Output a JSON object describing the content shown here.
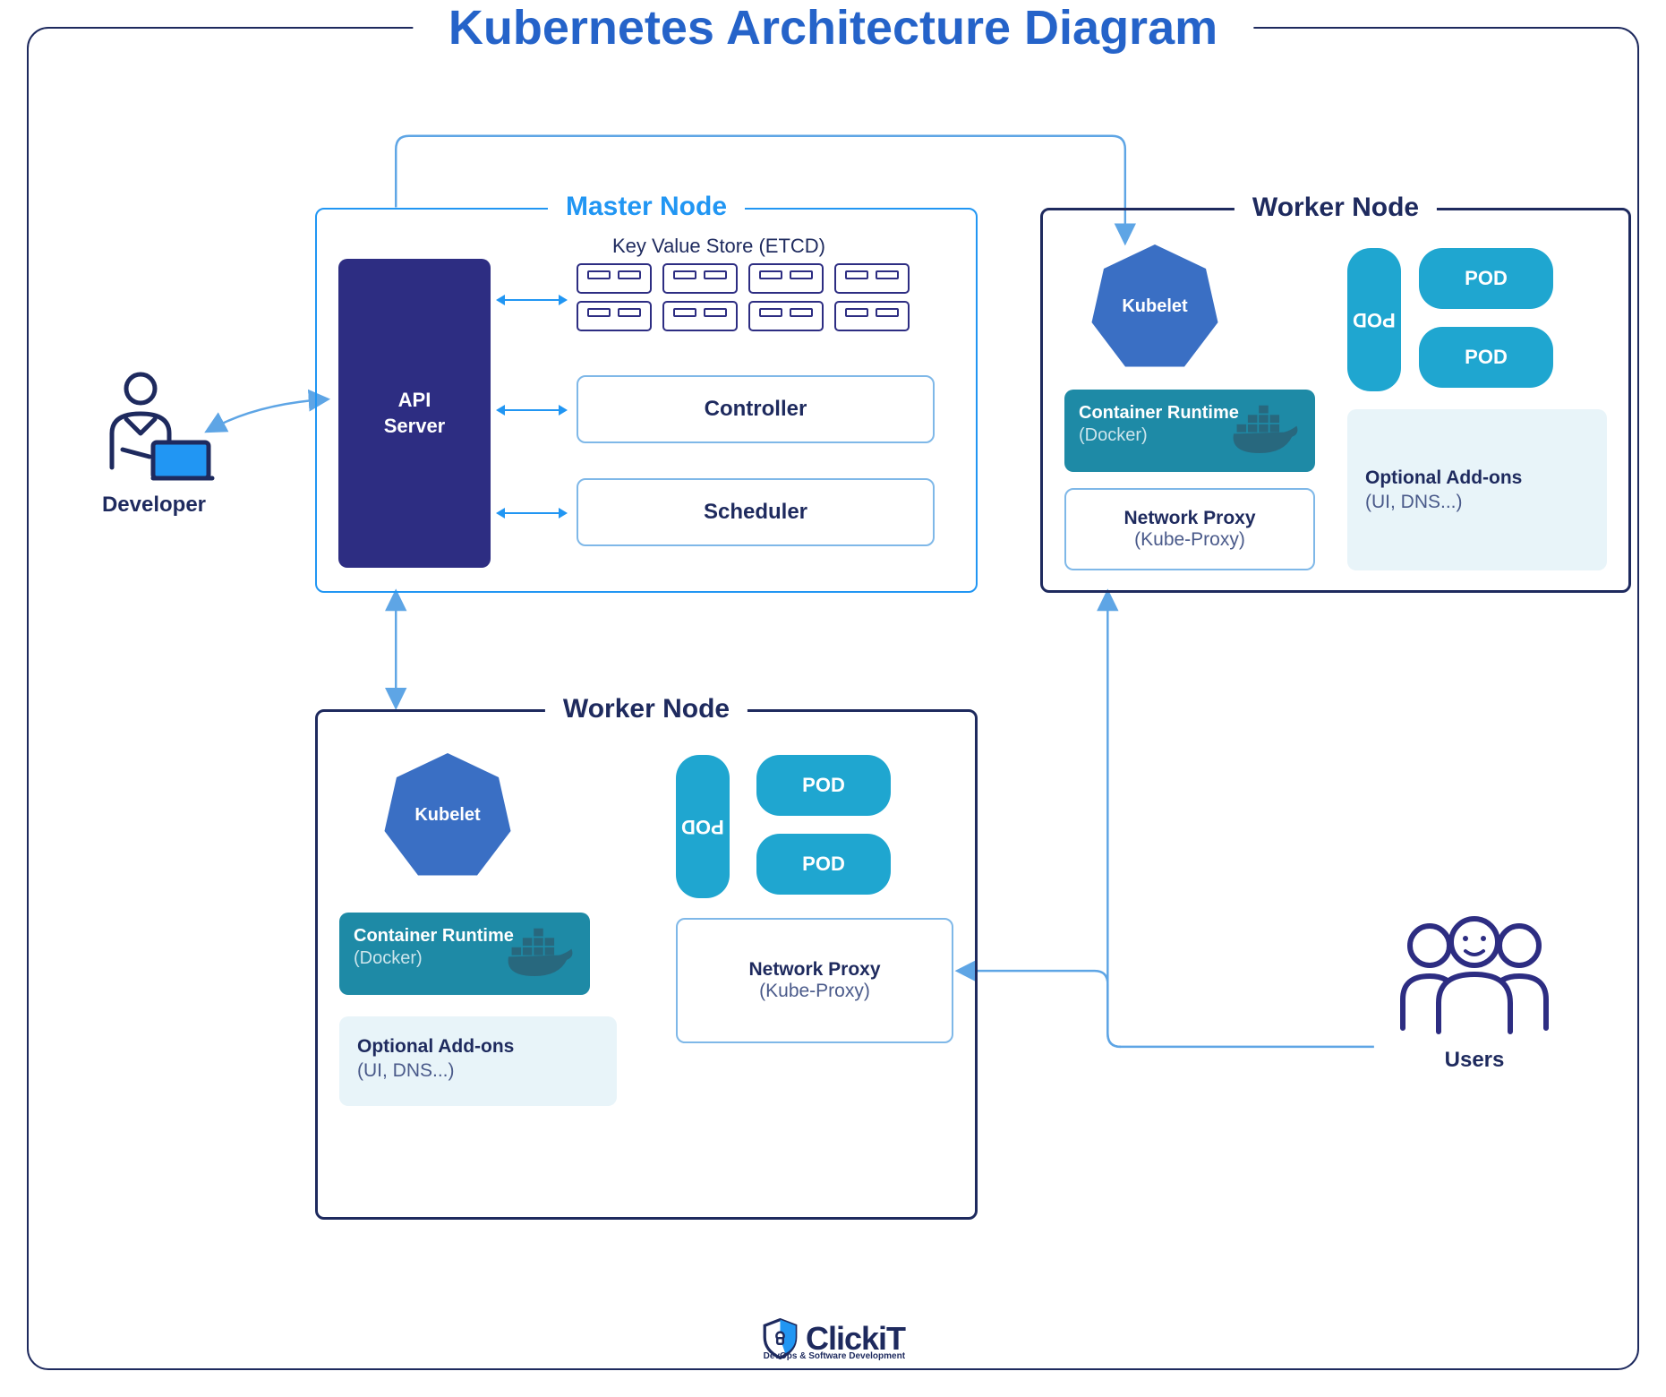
{
  "title": "Kubernetes Architecture Diagram",
  "actors": {
    "developer": "Developer",
    "users": "Users"
  },
  "master": {
    "title": "Master Node",
    "api_server": "API\nServer",
    "etcd_label": "Key Value Store (ETCD)",
    "controller": "Controller",
    "scheduler": "Scheduler"
  },
  "worker_top": {
    "title": "Worker Node",
    "kubelet": "Kubelet",
    "container_runtime_title": "Container Runtime",
    "container_runtime_sub": "(Docker)",
    "network_proxy_title": "Network Proxy",
    "network_proxy_sub": "(Kube-Proxy)",
    "pods": {
      "vert": "POD",
      "h1": "POD",
      "h2": "POD"
    },
    "addons_title": "Optional Add-ons",
    "addons_sub": "(UI, DNS...)"
  },
  "worker_bottom": {
    "title": "Worker Node",
    "kubelet": "Kubelet",
    "container_runtime_title": "Container Runtime",
    "container_runtime_sub": "(Docker)",
    "network_proxy_title": "Network Proxy",
    "network_proxy_sub": "(Kube-Proxy)",
    "pods": {
      "vert": "POD",
      "h1": "POD",
      "h2": "POD"
    },
    "addons_title": "Optional Add-ons",
    "addons_sub": "(UI, DNS...)"
  },
  "logo": {
    "name": "ClickiT",
    "tagline": "DevOps & Software Development"
  },
  "colors": {
    "navy": "#1e2a5e",
    "blue": "#2563c9",
    "bright_blue": "#2196f3",
    "cyan": "#1fa6d0",
    "teal": "#1e8aa6",
    "deep_purple": "#2d2d82"
  }
}
